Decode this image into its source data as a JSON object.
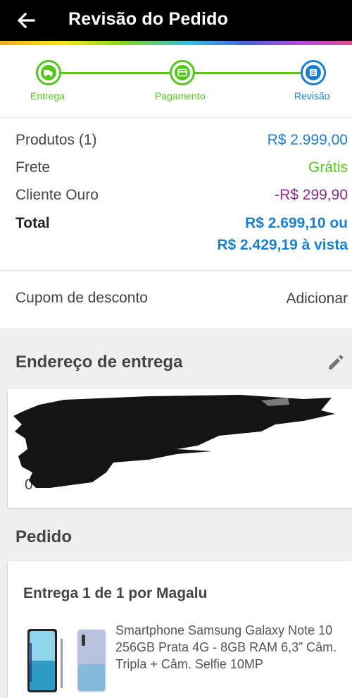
{
  "header": {
    "title": "Revisão do Pedido",
    "back_icon": "arrow-left-icon"
  },
  "stepper": {
    "steps": [
      {
        "label": "Entrega",
        "icon": "truck-icon",
        "color": "#54c61c"
      },
      {
        "label": "Pagamento",
        "icon": "card-icon",
        "color": "#54c61c"
      },
      {
        "label": "Revisão",
        "icon": "list-icon",
        "color": "#1a7fcc"
      }
    ]
  },
  "summary": {
    "products_label": "Produtos (1)",
    "products_value": "R$ 2.999,00",
    "shipping_label": "Frete",
    "shipping_value": "Grátis",
    "gold_label": "Cliente Ouro",
    "gold_value": "-R$ 299,90",
    "total_label": "Total",
    "total_value_line1": "R$ 2.699,10 ou",
    "total_value_line2": "R$ 2.429,19 à vista"
  },
  "coupon": {
    "label": "Cupom de desconto",
    "action": "Adicionar"
  },
  "address": {
    "title": "Endereço de entrega",
    "edit_icon": "pencil-icon",
    "visible_fragment": "0"
  },
  "order": {
    "title": "Pedido",
    "delivery_label": "Entrega 1 de 1 por Magalu",
    "product_name": "Smartphone Samsung Galaxy Note 10 256GB Prata 4G - 8GB RAM 6,3” Câm. Tripla + Câm. Selfie 10MP"
  },
  "colors": {
    "accent_blue": "#1a7fcc",
    "accent_green": "#54c61c",
    "discount_purple": "#8b2a8c",
    "header_bg": "#000000"
  }
}
